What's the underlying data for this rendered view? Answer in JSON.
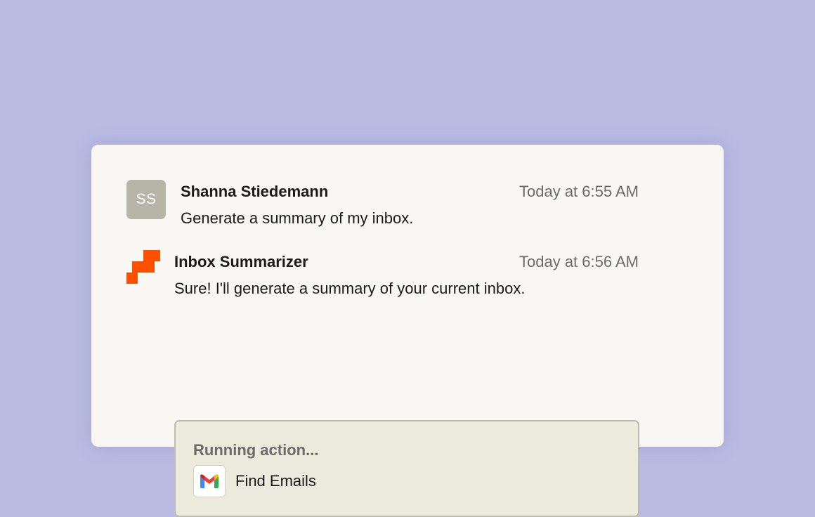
{
  "colors": {
    "background": "#babbe3",
    "card": "#f8f7f4",
    "avatar": "#b7b4a8",
    "brand_orange": "#ff4f00",
    "action_box": "#ece9dd",
    "muted_text": "#6f6b66"
  },
  "messages": [
    {
      "avatar_initials": "SS",
      "author": "Shanna Stiedemann",
      "time": "Today at 6:55 AM",
      "text": "Generate a summary of my inbox."
    },
    {
      "avatar_icon": "zapier-logo-icon",
      "author": "Inbox Summarizer",
      "time": "Today at 6:56 AM",
      "text": "Sure! I'll generate a summary of your current inbox."
    }
  ],
  "action": {
    "status": "Running action...",
    "icon": "gmail-icon",
    "label": "Find Emails"
  }
}
